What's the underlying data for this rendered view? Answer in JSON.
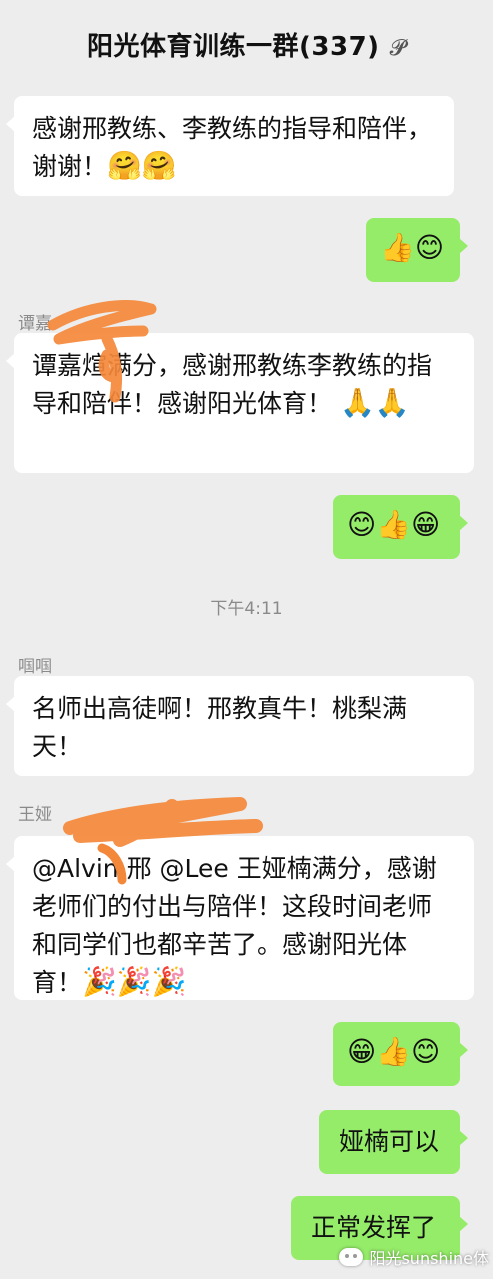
{
  "header": {
    "title": "阳光体育训练一群(337)",
    "ear_icon": "ear-icon"
  },
  "messages": {
    "m1": {
      "text": "感谢邢教练、李教练的指导和陪伴，谢谢！",
      "emoji": "🤗🤗"
    },
    "m2": {
      "emoji": "👍😊"
    },
    "m3": {
      "sender": "谭嘉",
      "text": "谭嘉煊满分，感谢邢教练李教练的指导和陪伴！感谢阳光体育！",
      "emoji": "🙏🙏"
    },
    "m4": {
      "emoji": "😊👍😁"
    },
    "time": "下午4:11",
    "m5": {
      "sender": "啯啯",
      "text": "名师出高徒啊！邢教真牛！桃梨满天！"
    },
    "m6": {
      "sender": "王娅",
      "text": "@Alvin 邢  @Lee  王娅楠满分，感谢老师们的付出与陪伴！这段时间老师和同学们也都辛苦了。感谢阳光体育！",
      "emoji": "🎉🎉🎉"
    },
    "m7": {
      "emoji": "😁👍😊"
    },
    "m8": {
      "text": "娅楠可以"
    },
    "m9": {
      "text": "正常发挥了"
    }
  },
  "watermark": {
    "text": "阳光sunshine体"
  },
  "colors": {
    "background": "#ededed",
    "bubble_in": "#ffffff",
    "bubble_out": "#95ec69",
    "redaction": "#f4883a"
  }
}
